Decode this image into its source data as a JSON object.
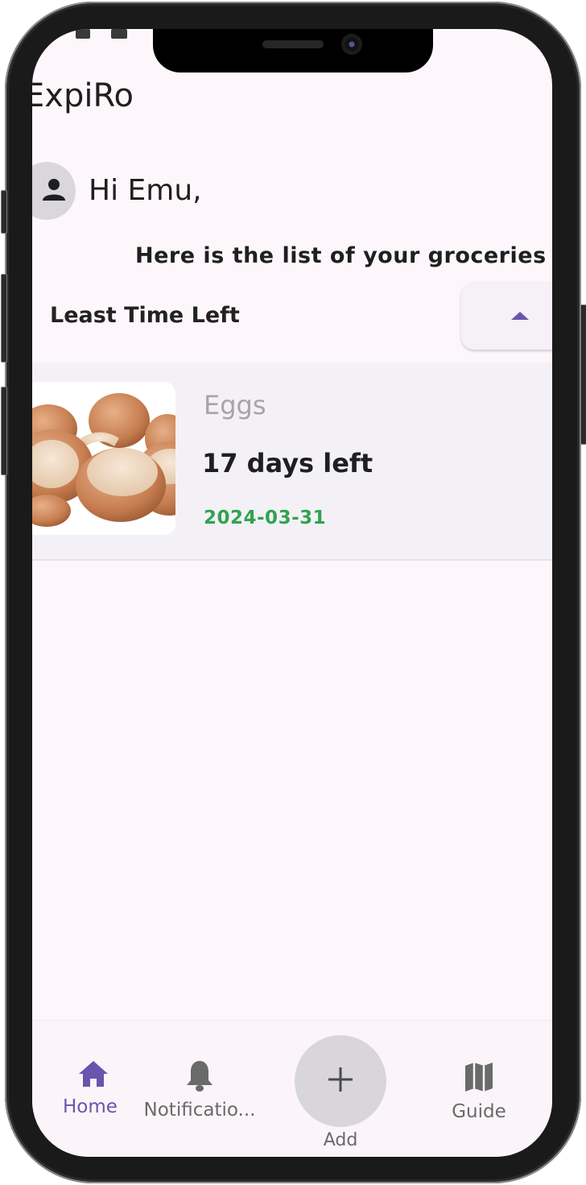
{
  "app": {
    "title": "ExpiRo"
  },
  "user": {
    "greeting": "Hi Emu,"
  },
  "list": {
    "subtitle": "Here is the list of your groceries",
    "sort_label": "Least Time Left",
    "sort_icon": "arrow-up-icon"
  },
  "items": [
    {
      "name": "Eggs",
      "days_left": "17 days left",
      "expiry_date": "2024-03-31",
      "image": "eggshells"
    }
  ],
  "nav": {
    "home": "Home",
    "notifications": "Notificatio...",
    "add": "Add",
    "guide": "Guide"
  },
  "colors": {
    "accent": "#6a54ad",
    "screen_bg": "#fdf7fb",
    "card_bg": "#f4f1f6",
    "date_green": "#2fa44f"
  }
}
